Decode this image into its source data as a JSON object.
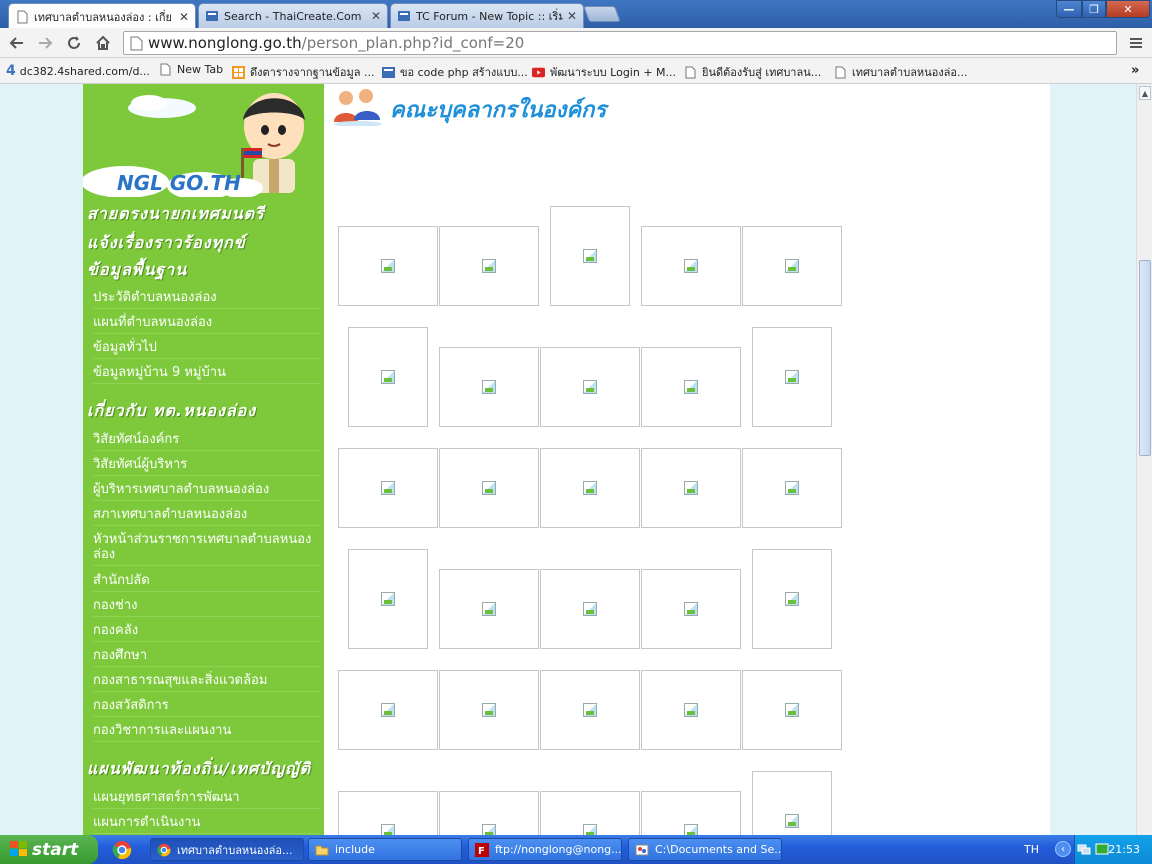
{
  "browser": {
    "tabs": [
      {
        "label": "เทศบาลตำบลหนองล่อง : เกี่ย",
        "active": true
      },
      {
        "label": "Search - ThaiCreate.Com",
        "active": false
      },
      {
        "label": "TC Forum - New Topic :: เริ่ม",
        "active": false
      }
    ],
    "url_host": "www.nonglong.go.th",
    "url_path": "/person_plan.php?id_conf=20",
    "bookmarks": [
      "dc382.4shared.com/d...",
      "New Tab",
      "ดึงตารางจากฐานข้อมูล ...",
      "ขอ code php สร้างแบบ...",
      "พัฒนาระบบ Login + M...",
      "ยินดีต้องรับสู่ เทศบาลน...",
      "เทศบาลตำบลหนองล่อ..."
    ]
  },
  "sidebar": {
    "logo_text": "NGL  GO.TH",
    "section_1": "สายตรงนายกเทศมนตรี",
    "section_2": "แจ้งเรื่องราวร้องทุกข์",
    "section_3": "ข้อมูลพื้นฐาน",
    "basic_items": [
      "ประวัติตำบลหนองล่อง",
      "แผนที่ตำบลหนองล่อง",
      "ข้อมูลทั่วไป",
      "ข้อมูลหมู่บ้าน 9 หมู่บ้าน"
    ],
    "section_4": "เกี่ยวกับ ทต.หนองล่อง",
    "about_items": [
      "วิสัยทัศน์องค์กร",
      "วิสัยทัศน์ผู้บริหาร",
      "ผู้บริหารเทศบาลตำบลหนองล่อง",
      "สภาเทศบาลตำบลหนองล่อง",
      "หัวหน้าส่วนราชการเทศบาลตำบลหนองล่อง",
      "สำนักปลัด",
      "กองช่าง",
      "กองคลัง",
      "กองศึกษา",
      "กองสาธารณสุขและสิ่งแวดล้อม",
      "กองสวัสดิการ",
      "กองวิชาการและแผนงาน"
    ],
    "section_5": "แผนพัฒนาท้องถิ่น/เทศบัญญัติ",
    "plan_items": [
      "แผนยุทธศาสตร์การพัฒนา",
      "แผนการดำเนินงาน"
    ]
  },
  "content": {
    "title": "คณะบุคลากรในองค์กร"
  },
  "taskbar": {
    "start_label": "start",
    "tasks": [
      "เทศบาลตำบลหนองล่อ...",
      "include",
      "ftp://nonglong@nong...",
      "C:\\Documents and Se..."
    ],
    "language": "TH",
    "clock": "21:53"
  },
  "colors": {
    "sidebar_green": "#7dc93b",
    "title_blue": "#1e8fd8",
    "taskbar_blue": "#245edb"
  }
}
